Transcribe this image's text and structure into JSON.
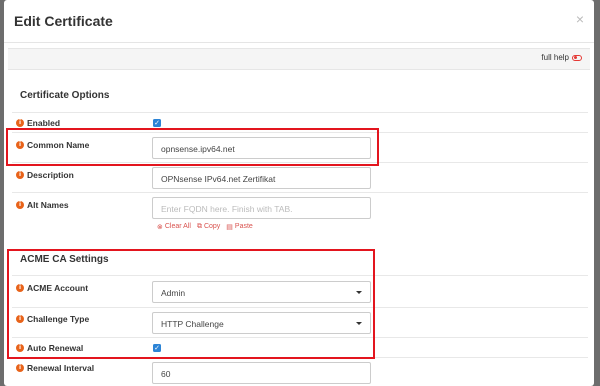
{
  "modal": {
    "title": "Edit Certificate",
    "close_glyph": "×",
    "full_help_label": "full help"
  },
  "sections": {
    "certificate_options": "Certificate Options",
    "acme_settings": "ACME CA Settings"
  },
  "fields": {
    "enabled": {
      "label": "Enabled",
      "checked": true
    },
    "common_name": {
      "label": "Common Name",
      "value": "opnsense.ipv64.net"
    },
    "description": {
      "label": "Description",
      "value": "OPNsense IPv64.net Zertifikat"
    },
    "alt_names": {
      "label": "Alt Names",
      "placeholder": "Enter FQDN here. Finish with TAB.",
      "clear_all": "Clear All",
      "copy": "Copy",
      "paste": "Paste"
    },
    "acme_account": {
      "label": "ACME Account",
      "value": "Admin"
    },
    "challenge_type": {
      "label": "Challenge Type",
      "value": "HTTP Challenge"
    },
    "auto_renewal": {
      "label": "Auto Renewal",
      "checked": true
    },
    "renewal_interval": {
      "label": "Renewal Interval",
      "value": "60"
    }
  },
  "icons": {
    "info": "i",
    "check": "✓"
  },
  "colors": {
    "accent_blue": "#2c84d6",
    "info_orange": "#e8631a",
    "highlight_red": "#e3151e",
    "action_red": "#d9534f"
  }
}
